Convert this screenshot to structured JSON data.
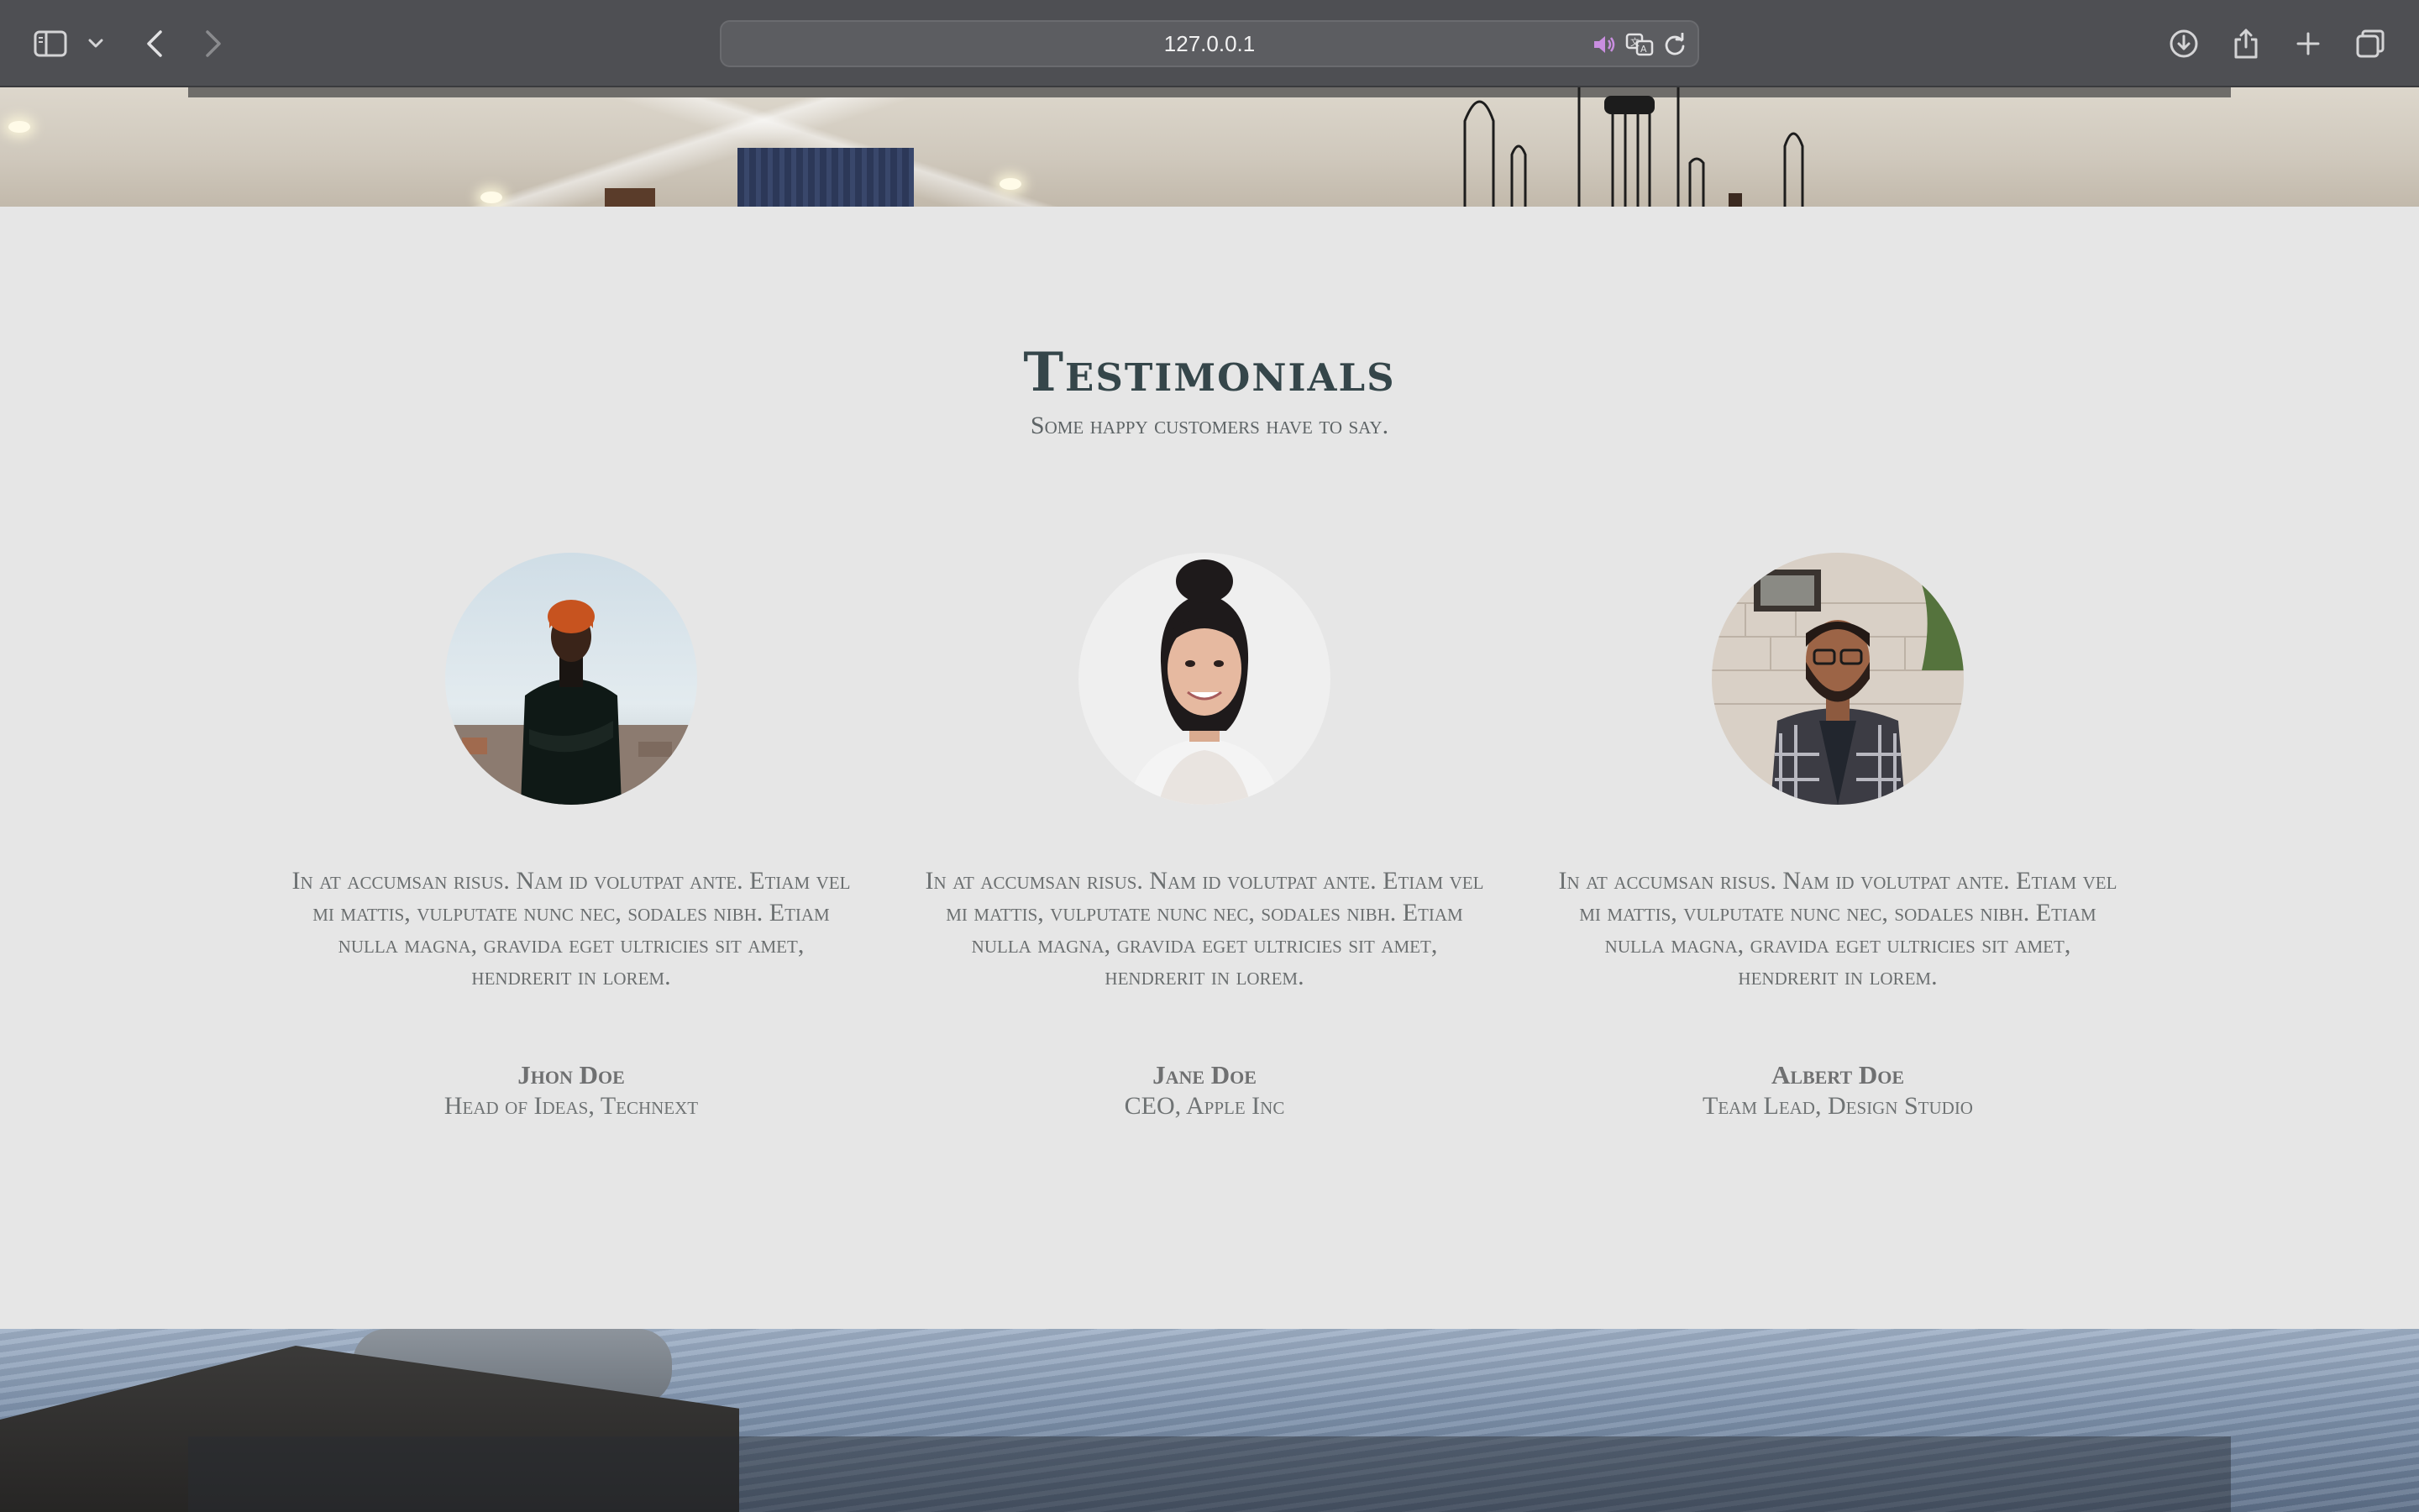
{
  "browser": {
    "url": "127.0.0.1",
    "icons": {
      "sidebar": "sidebar-icon",
      "sidebar_menu": "chevron-down-icon",
      "back": "chevron-left-icon",
      "forward": "chevron-right-icon",
      "audio": "speaker-icon",
      "translate": "translate-icon",
      "reload": "reload-icon",
      "download": "download-icon",
      "share": "share-icon",
      "new_tab": "plus-icon",
      "tabs": "tabs-overview-icon"
    },
    "colors": {
      "toolbar": "#4e4f53",
      "audio_accent": "#c98ee0"
    }
  },
  "testimonials": {
    "title": "Testimonials",
    "subtitle": "Some happy customers have to say.",
    "items": [
      {
        "quote": "In at accumsan risus. Nam id volutpat ante. Etiam vel mi mattis, vulputate nunc nec, sodales nibh. Etiam nulla magna, gravida eget ultricies sit amet, hendrerit in lorem.",
        "name": "Jhon Doe",
        "role": "Head of Ideas, Technext"
      },
      {
        "quote": "In at accumsan risus. Nam id volutpat ante. Etiam vel mi mattis, vulputate nunc nec, sodales nibh. Etiam nulla magna, gravida eget ultricies sit amet, hendrerit in lorem.",
        "name": "Jane Doe",
        "role": "CEO, Apple Inc"
      },
      {
        "quote": "In at accumsan risus. Nam id volutpat ante. Etiam vel mi mattis, vulputate nunc nec, sodales nibh. Etiam nulla magna, gravida eget ultricies sit amet, hendrerit in lorem.",
        "name": "Albert Doe",
        "role": "Team Lead, Design Studio"
      }
    ]
  }
}
